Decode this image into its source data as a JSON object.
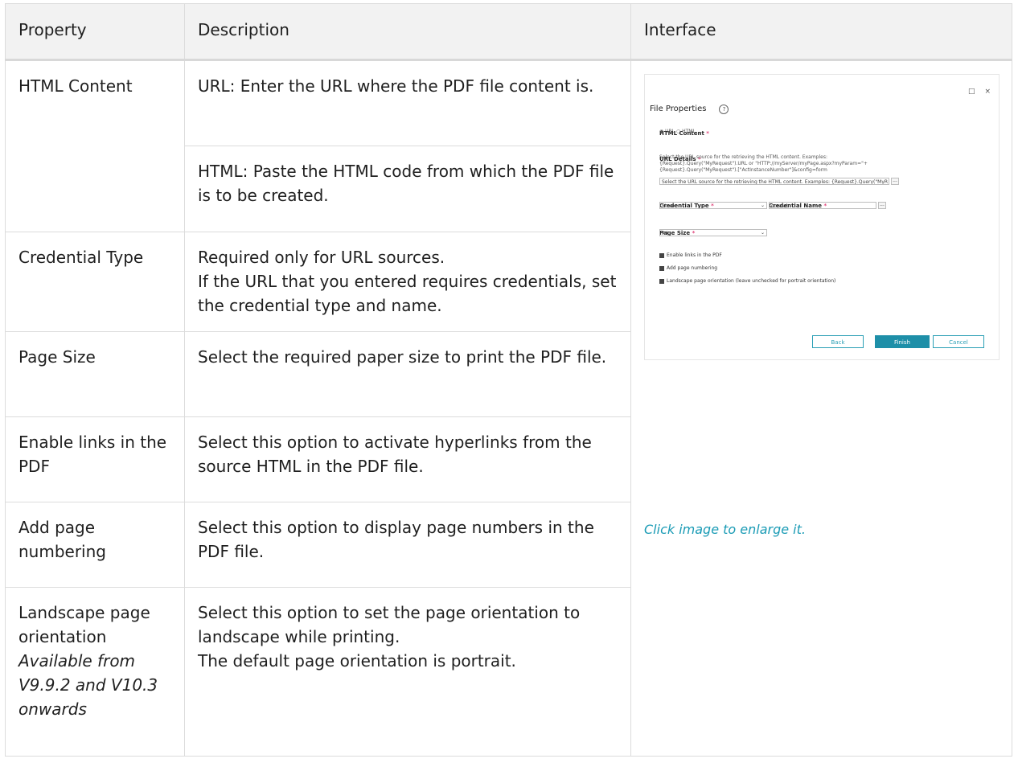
{
  "headers": {
    "property": "Property",
    "description": "Description",
    "interface": "Interface"
  },
  "rows": [
    {
      "property": "HTML Content",
      "description": "URL: Enter the URL where the PDF file content is."
    },
    {
      "description": "HTML: Paste the HTML code from which the PDF file is to be created."
    },
    {
      "property": "Credential Type",
      "description_lines": [
        "Required only for URL sources.",
        "If the URL that you entered requires credentials, set the credential type and name."
      ]
    },
    {
      "property": "Page Size",
      "description": "Select the required paper size to print the PDF file."
    },
    {
      "property": "Enable links in the PDF",
      "description": "Select this option to activate hyperlinks from the source HTML in the PDF file."
    },
    {
      "property": "Add page numbering",
      "description": "Select this option to display page numbers in the PDF file."
    },
    {
      "property": "Landscape page orientation",
      "availability": "Available from V9.9.2  and V10.3 onwards",
      "description_lines": [
        "Select this option to set the page orientation to landscape while printing.",
        "The default page orientation is portrait."
      ]
    }
  ],
  "thumbnail": {
    "window_icons": [
      "□",
      "×"
    ],
    "title": "File Properties",
    "help_icon": "?",
    "html_content_label": "HTML Content",
    "required_mark": "*",
    "radio_url": "URL",
    "radio_html": "HTML",
    "url_details_label": "URL Details",
    "url_help_1": "Select the URL source for the retrieving the HTML content. Examples:",
    "url_help_2": "{Request}.Query(\"MyRequest\").URL or \"HTTP://myServer/myPage.aspx?myParam=\"+",
    "url_help_3": "{Request}.Query(\"MyRequest\").[\"ActInstanceNumber\"]&config=form",
    "url_placeholder": "Select the URL source for the retrieving the HTML content. Examples: {Request}.Query(\"MyR",
    "dots": "...",
    "credential_type_label": "Credential Type",
    "credential_type_value": "Store",
    "credential_name_label": "Credential Name",
    "credential_name_value": "coralab",
    "page_size_label": "Page Size",
    "page_size_value": "A4",
    "chk_links": "Enable links in the PDF",
    "chk_numbering": "Add page numbering",
    "chk_landscape": "Landscape page orientation (leave unchecked for portrait orientation)",
    "btn_back": "Back",
    "btn_finish": "Finish",
    "btn_cancel": "Cancel",
    "dropdown_glyph": "⌄"
  },
  "caption": "Click image to enlarge it."
}
